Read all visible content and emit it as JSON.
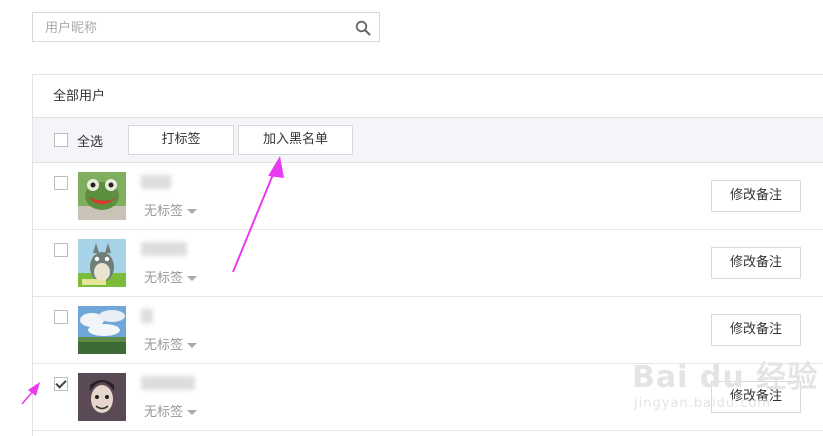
{
  "search": {
    "placeholder": "用户昵称",
    "icon": "search-icon"
  },
  "panel": {
    "title": "全部用户",
    "toolbar": {
      "select_all_label": "全选",
      "tag_button": "打标签",
      "blacklist_button": "加入黑名单"
    },
    "users": [
      {
        "tag_label": "无标签",
        "remark_button": "修改备注",
        "checked": false,
        "avatar": "frog-avatar"
      },
      {
        "tag_label": "无标签",
        "remark_button": "修改备注",
        "checked": false,
        "avatar": "totoro-avatar"
      },
      {
        "tag_label": "无标签",
        "remark_button": "修改备注",
        "checked": false,
        "avatar": "sky-landscape-avatar"
      },
      {
        "tag_label": "无标签",
        "remark_button": "修改备注",
        "checked": true,
        "avatar": "portrait-avatar"
      }
    ]
  },
  "watermark": {
    "main": "Bai du 经验",
    "sub": "jingyan.baidu.com"
  },
  "colors": {
    "annotation_arrow": "#e83bf0",
    "toolbar_bg": "#f4f5f9",
    "border": "#e2e2e2"
  }
}
